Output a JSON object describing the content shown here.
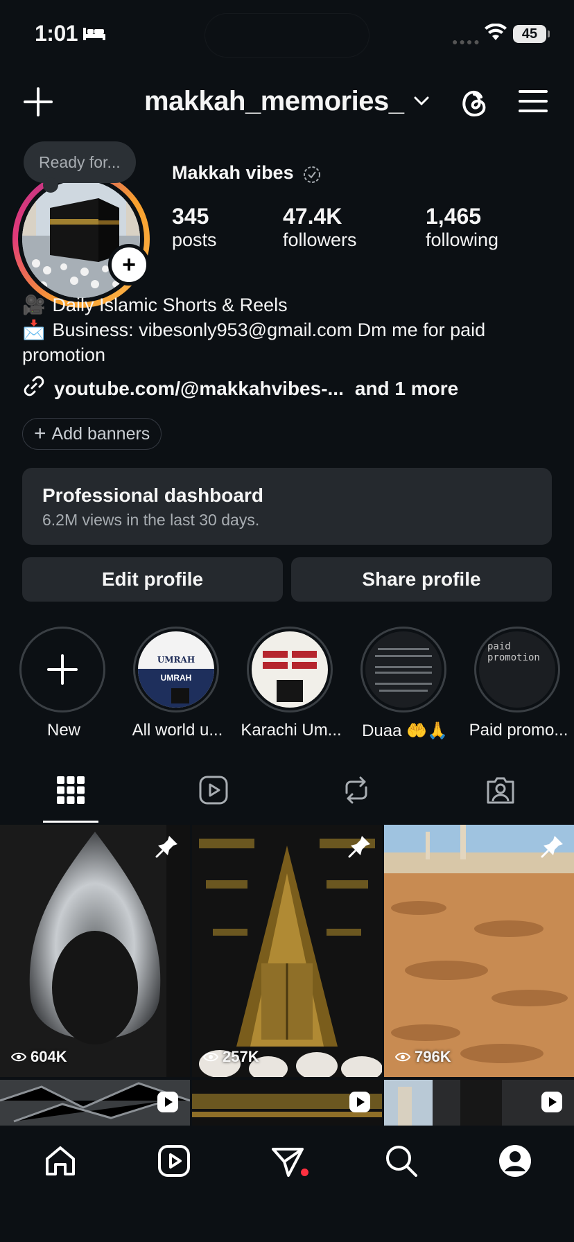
{
  "status_bar": {
    "time": "1:01",
    "battery": "45"
  },
  "header": {
    "username": "makkah_memories_"
  },
  "profile": {
    "note": "Ready for...",
    "display_name": "Makkah vibes",
    "stats": [
      {
        "value": "345",
        "label": "posts"
      },
      {
        "value": "47.4K",
        "label": "followers"
      },
      {
        "value": "1,465",
        "label": "following"
      }
    ],
    "bio": {
      "line1": "Daily Islamic Shorts & Reels",
      "line2": "Business: vibesonly953@gmail.com Dm me for paid promotion"
    },
    "link": {
      "text": "youtube.com/@makkahvibes-...",
      "more": "and 1 more"
    },
    "add_banners": "Add banners"
  },
  "dashboard": {
    "title": "Professional dashboard",
    "subtitle": "6.2M views in the last 30 days."
  },
  "buttons": {
    "edit": "Edit profile",
    "share": "Share profile"
  },
  "highlights": [
    {
      "label": "New"
    },
    {
      "label": "All world u..."
    },
    {
      "label": "Karachi Um..."
    },
    {
      "label": "Duaa 🤲🙏"
    },
    {
      "label": "Paid promo..."
    }
  ],
  "highlight_texts": {
    "umrah": "UMRAH",
    "umrah2": "UMRAH",
    "paid": "paid promotion"
  },
  "tabs": [
    "grid-icon",
    "reels-icon",
    "reposts-icon",
    "tagged-icon"
  ],
  "posts": [
    {
      "views": "604K",
      "pinned": true
    },
    {
      "views": "257K",
      "pinned": true
    },
    {
      "views": "796K",
      "pinned": true
    }
  ],
  "colors": {
    "background": "#0c1014",
    "button": "#25292e",
    "accent_red": "#ff3040"
  }
}
